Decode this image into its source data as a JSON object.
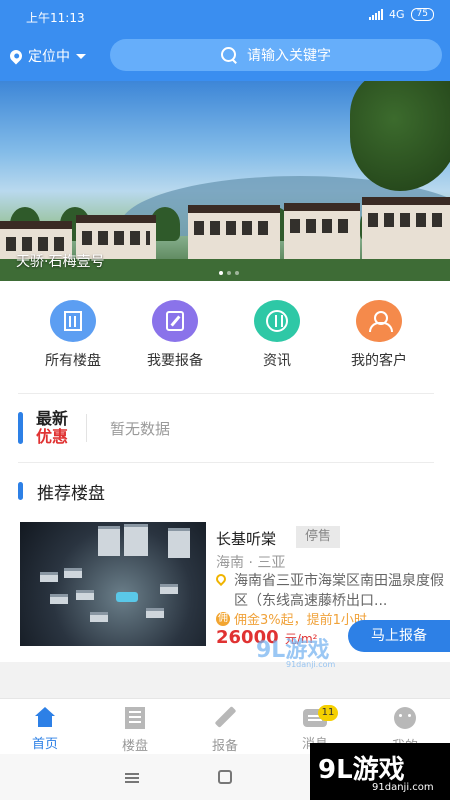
{
  "status_bar": {
    "time": "上午11:13",
    "network": "4G",
    "battery": "75"
  },
  "header": {
    "location_label": "定位中",
    "search_placeholder": "请输入关键字"
  },
  "banner": {
    "caption": "天骄·石梅壹号"
  },
  "quick_menu": [
    {
      "label": "所有楼盘",
      "icon": "building-icon",
      "color": "#5c9ef2"
    },
    {
      "label": "我要报备",
      "icon": "edit-doc-icon",
      "color": "#8a73ea"
    },
    {
      "label": "资讯",
      "icon": "news-icon",
      "color": "#2ec8a6"
    },
    {
      "label": "我的客户",
      "icon": "customers-icon",
      "color": "#f58a4b"
    }
  ],
  "promo": {
    "title_line1": "最新",
    "title_line2": "优惠",
    "empty_text": "暂无数据"
  },
  "recommended": {
    "section_title": "推荐楼盘",
    "listing": {
      "name": "长基听棠",
      "status_tag": "停售",
      "region": "海南 · 三亚",
      "address": "海南省三亚市海棠区南田温泉度假区（东线高速藤桥出口...",
      "commission_badge": "佣",
      "commission": "佣金3%起，提前1小时",
      "price": "26000",
      "price_unit": "元/m²"
    },
    "report_button": "马上报备"
  },
  "tabbar": [
    {
      "label": "首页",
      "active": true
    },
    {
      "label": "楼盘",
      "active": false
    },
    {
      "label": "报备",
      "active": false
    },
    {
      "label": "消息",
      "active": false,
      "badge": "11"
    },
    {
      "label": "我的",
      "active": false
    }
  ],
  "watermark": {
    "brand": "9L游戏",
    "domain": "91danji.com"
  },
  "colors": {
    "primary": "#3a8ef0",
    "accent_red": "#e03232",
    "commission_orange": "#f0a23a"
  }
}
